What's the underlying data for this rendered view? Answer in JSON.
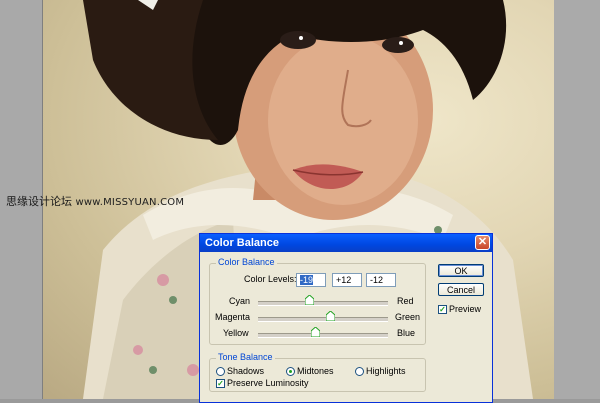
{
  "watermark": {
    "chinese": "思缘设计论坛",
    "url": "www.MISSYUAN.COM"
  },
  "dialog": {
    "title": "Color Balance",
    "color_balance_group": "Color Balance",
    "color_levels_label": "Color Levels:",
    "levels": [
      "-19",
      "+12",
      "-12"
    ],
    "sliders": [
      {
        "left": "Cyan",
        "right": "Red",
        "value": -19
      },
      {
        "left": "Magenta",
        "right": "Green",
        "value": 12
      },
      {
        "left": "Yellow",
        "right": "Blue",
        "value": -12
      }
    ],
    "tone_balance_group": "Tone Balance",
    "tones": [
      {
        "label": "Shadows",
        "checked": false
      },
      {
        "label": "Midtones",
        "checked": true
      },
      {
        "label": "Highlights",
        "checked": false
      }
    ],
    "preserve_luminosity": "Preserve Luminosity",
    "ok": "OK",
    "cancel": "Cancel",
    "preview": "Preview",
    "colors": {
      "title_bar": "#0047e0",
      "dialog_bg": "#ece9d8",
      "group_label": "#0046d5"
    }
  }
}
